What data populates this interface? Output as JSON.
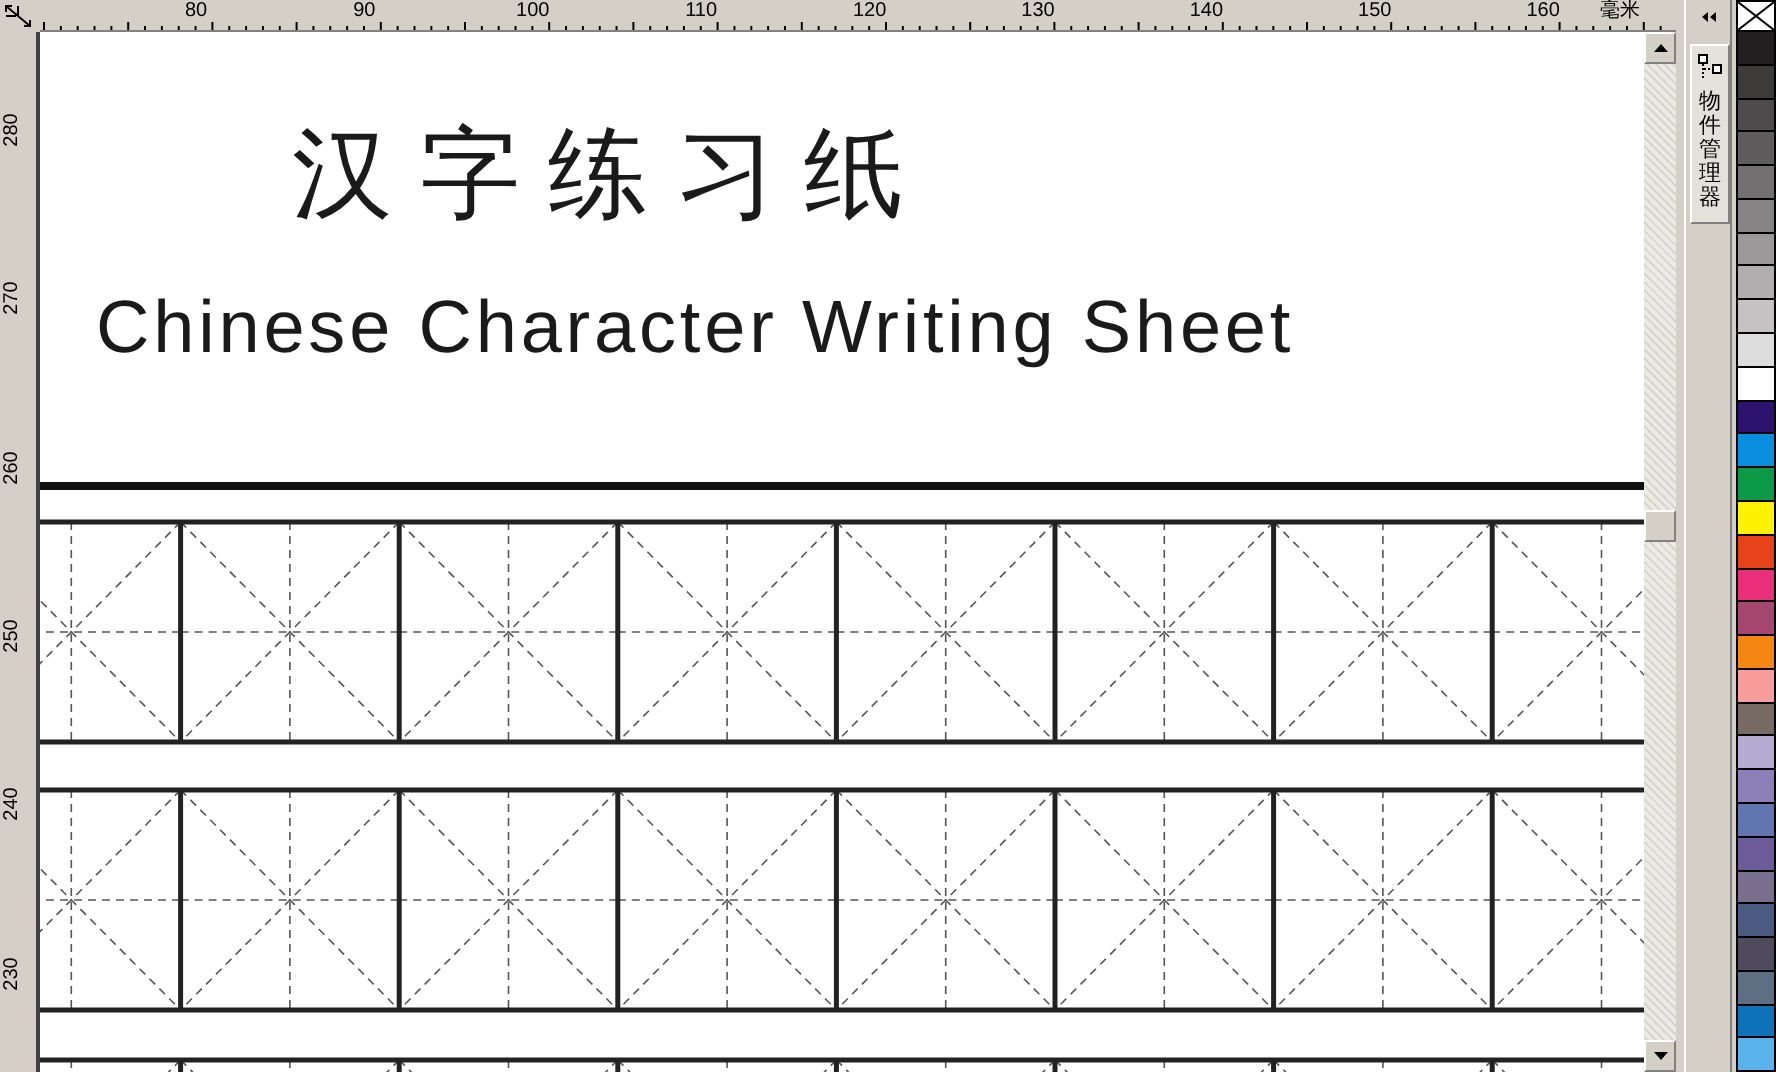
{
  "ruler": {
    "unit": "毫米",
    "top_labels": [
      "80",
      "90",
      "100",
      "110",
      "120",
      "130",
      "140",
      "150",
      "160"
    ],
    "left_labels": [
      "280",
      "270",
      "260",
      "250",
      "240",
      "230"
    ]
  },
  "page": {
    "title_chinese": "汉字练习纸",
    "title_english": "Chinese Character Writing Sheet"
  },
  "docker": {
    "tabs": [
      {
        "label": "物件管理器",
        "selected": true
      }
    ]
  },
  "palette": {
    "swatches": [
      {
        "color": "#231f20"
      },
      {
        "color": "#3d3a3a"
      },
      {
        "color": "#4d4b4b"
      },
      {
        "color": "#5e5c5c"
      },
      {
        "color": "#727070"
      },
      {
        "color": "#868484"
      },
      {
        "color": "#9b9999"
      },
      {
        "color": "#b0aeae"
      },
      {
        "color": "#c4c2c2"
      },
      {
        "color": "#dcdcdc"
      },
      {
        "color": "#ffffff"
      },
      {
        "color": "#2e1270"
      },
      {
        "color": "#0a8ee0"
      },
      {
        "color": "#0d9a48"
      },
      {
        "color": "#fff200"
      },
      {
        "color": "#e8421a"
      },
      {
        "color": "#e92f7a"
      },
      {
        "color": "#a5466e"
      },
      {
        "color": "#f58613"
      },
      {
        "color": "#f79d9a"
      },
      {
        "color": "#766a62"
      },
      {
        "color": "#b6abd0"
      },
      {
        "color": "#8d7fb8"
      },
      {
        "color": "#6175b0"
      },
      {
        "color": "#6e5b9a"
      },
      {
        "color": "#7a6e8e"
      },
      {
        "color": "#4a5a80"
      },
      {
        "color": "#4f4a5c"
      },
      {
        "color": "#5d6f82"
      },
      {
        "color": "#0d72b8"
      },
      {
        "color": "#5ab3ea"
      }
    ]
  }
}
